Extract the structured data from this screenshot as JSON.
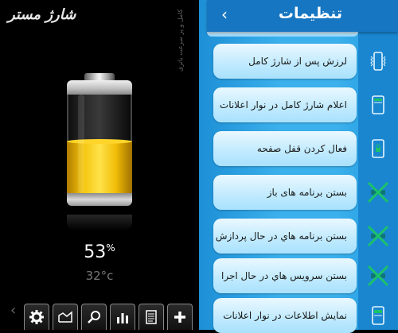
{
  "left_panel": {
    "brand": "شارژ مستر",
    "side_text": "شارژ کامل و پر سرعت باتری",
    "battery_level_percent": 53,
    "percent_value": "53",
    "percent_sign": "%",
    "temperature": "32°c",
    "colors": {
      "fill": "#f4c40a",
      "background": "#000000"
    },
    "toolbar": [
      {
        "icon": "gear-icon"
      },
      {
        "icon": "chart-area-icon"
      },
      {
        "icon": "search-icon"
      },
      {
        "icon": "bar-chart-icon"
      },
      {
        "icon": "notes-icon"
      },
      {
        "icon": "plus-icon"
      }
    ],
    "chevron": "‹"
  },
  "right_panel": {
    "title": "تنظیمات",
    "back_icon": "‹",
    "colors": {
      "header": "#1676c2",
      "background": "#3ab0ec",
      "row": "#bfeafe"
    },
    "items": [
      {
        "label": "لرزش پس از شارژ کامل",
        "icon": "phone-vibrate-icon"
      },
      {
        "label": "اعلام شارژ کامل در نوار اعلانات",
        "icon": "phone-notification-icon"
      },
      {
        "label": "فعال کردن قفل صفحه",
        "icon": "phone-lock-icon"
      },
      {
        "label": "بستن برنامه های باز",
        "icon": "close-apps-icon"
      },
      {
        "label": "بستن برنامه هاي در حال پردازش",
        "icon": "close-processes-icon"
      },
      {
        "label": "بستن سرويس هاي در حال اجرا",
        "icon": "close-services-icon"
      },
      {
        "label": "نمايش اطلاعات در نوار اعلانات",
        "icon": "phone-info-icon"
      }
    ]
  }
}
